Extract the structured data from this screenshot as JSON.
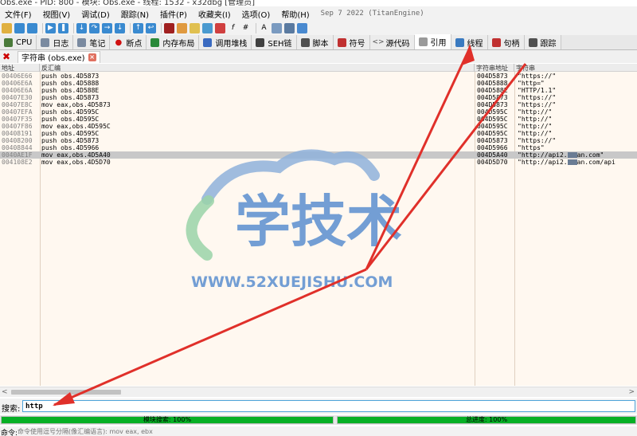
{
  "window": {
    "title": "Obs.exe - PID: 800 - 模块: Obs.exe - 线程: 1532 - x32dbg [管理员]"
  },
  "menu": {
    "items": [
      "文件(F)",
      "视图(V)",
      "调试(D)",
      "跟踪(N)",
      "插件(P)",
      "收藏夹(I)",
      "选项(O)",
      "帮助(H)"
    ],
    "build_date": "Sep 7 2022 (TitanEngine)"
  },
  "toolbar": {
    "icons": [
      "open-icon",
      "restart-icon",
      "close-icon",
      "run-icon",
      "pause-icon",
      "step-into-icon",
      "step-over-icon",
      "trace-into-icon",
      "trace-over-icon",
      "execute-till-return-icon",
      "run-to-user-code-icon",
      "scylla-icon",
      "edit-icon",
      "comment-icon",
      "bookmark-icon",
      "label-icon",
      "function-icon",
      "hash-icon",
      "font-icon",
      "copy-icon",
      "calculator-icon",
      "help-icon"
    ]
  },
  "tabs": [
    {
      "label": "CPU",
      "icon": "cpu-icon",
      "color": "#4a7a3a"
    },
    {
      "label": "日志",
      "icon": "log-icon",
      "color": "#7a8aa0"
    },
    {
      "label": "笔记",
      "icon": "notes-icon",
      "color": "#7a8aa0"
    },
    {
      "label": "断点",
      "icon": "breakpoint-icon",
      "color": "#d01010"
    },
    {
      "label": "内存布局",
      "icon": "memory-map-icon",
      "color": "#2a8a3a"
    },
    {
      "label": "调用堆栈",
      "icon": "call-stack-icon",
      "color": "#3a6ac0"
    },
    {
      "label": "SEH链",
      "icon": "seh-icon",
      "color": "#404040"
    },
    {
      "label": "脚本",
      "icon": "script-icon",
      "color": "#505050"
    },
    {
      "label": "符号",
      "icon": "symbols-icon",
      "color": "#c03030"
    },
    {
      "label": "源代码",
      "icon": "source-icon",
      "color": "#505050"
    },
    {
      "label": "引用",
      "icon": "references-icon",
      "color": "#808080"
    },
    {
      "label": "线程",
      "icon": "threads-icon",
      "color": "#3a7ac0"
    },
    {
      "label": "句柄",
      "icon": "handles-icon",
      "color": "#c03030"
    },
    {
      "label": "跟踪",
      "icon": "trace-icon",
      "color": "#505050"
    }
  ],
  "subtab": {
    "label": "字符串 (obs.exe)"
  },
  "columns": {
    "address": "地址",
    "disassembly": "反汇编",
    "string_address": "字符串地址",
    "string": "字符串"
  },
  "rows": [
    {
      "address": "00406E66",
      "disasm": "push obs.4D5873",
      "str_addr": "004D5873",
      "string": "\"https://\""
    },
    {
      "address": "00406E6A",
      "disasm": "push obs.4D5888",
      "str_addr": "004D5888",
      "string": "\"http=\""
    },
    {
      "address": "00406E6A",
      "disasm": "push obs.4D588E",
      "str_addr": "004D588E",
      "string": "\"HTTP/1.1\""
    },
    {
      "address": "00407E30",
      "disasm": "push obs.4D5873",
      "str_addr": "004D5873",
      "string": "\"https://\""
    },
    {
      "address": "00407E8C",
      "disasm": "mov eax,obs.4D5873",
      "str_addr": "004D5873",
      "string": "\"https://\""
    },
    {
      "address": "00407EFA",
      "disasm": "push obs.4D595C",
      "str_addr": "004D595C",
      "string": "\"http://\""
    },
    {
      "address": "00407F35",
      "disasm": "push obs.4D595C",
      "str_addr": "004D595C",
      "string": "\"http://\""
    },
    {
      "address": "00407F86",
      "disasm": "mov eax,obs.4D595C",
      "str_addr": "004D595C",
      "string": "\"http://\""
    },
    {
      "address": "00408191",
      "disasm": "push obs.4D595C",
      "str_addr": "004D595C",
      "string": "\"http://\""
    },
    {
      "address": "00408200",
      "disasm": "push obs.4D5873",
      "str_addr": "004D5873",
      "string": "\"https://\""
    },
    {
      "address": "00408844",
      "disasm": "push obs.4D5966",
      "str_addr": "004D5966",
      "string": "\"https\""
    },
    {
      "address": "0040AE1F",
      "disasm": "mov eax,obs.4D5A40",
      "str_addr": "004D5A40",
      "string_a": "\"http://api2.",
      "string_b": "an.com\"",
      "selected": "true"
    },
    {
      "address": "004108E2",
      "disasm": "mov eax,obs.4D5D70",
      "str_addr": "004D5D70",
      "string_a": "\"http://api2.",
      "string_b": "an.com/api"
    }
  ],
  "watermark": {
    "text": "学技术",
    "url": "WWW.52XUEJISHU.COM"
  },
  "search": {
    "label": "搜索:",
    "value": "http"
  },
  "progress": {
    "module": {
      "label": "模块搜索: 100%",
      "percent": 100
    },
    "total": {
      "label": "总进度: 100%",
      "percent": 100
    }
  },
  "command": {
    "label": "命令:",
    "placeholder": "命令使用逗号分隔(像汇编语言): mov eax, ebx"
  },
  "colors": {
    "list_bg": "#fff8f0",
    "selection": "#c8c8c8",
    "progress_fill": "#06b025",
    "arrow": "#e0302a",
    "search_border": "#4da3d9"
  }
}
